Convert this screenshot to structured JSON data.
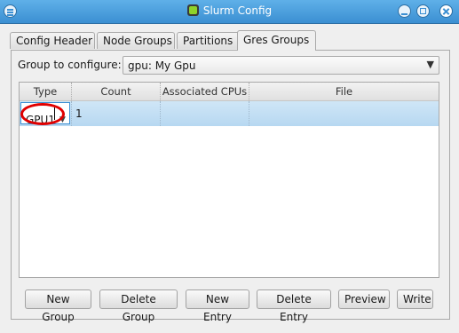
{
  "window": {
    "title": "Slurm Config"
  },
  "tabs": [
    {
      "label": "Config Header"
    },
    {
      "label": "Node Groups"
    },
    {
      "label": "Partitions"
    },
    {
      "label": "Gres Groups",
      "active": true
    }
  ],
  "group_select": {
    "label": "Group to configure:",
    "value": "gpu: My Gpu"
  },
  "table": {
    "columns": [
      "Type",
      "Count",
      "Associated CPUs",
      "File"
    ],
    "rows": [
      {
        "type": "GPU1",
        "count": "1",
        "associated_cpus": "",
        "file": ""
      }
    ]
  },
  "buttons": {
    "new_group": "New Group",
    "delete_group": "Delete Group",
    "new_entry": "New Entry",
    "delete_entry": "Delete Entry",
    "preview": "Preview",
    "write": "Write"
  },
  "colors": {
    "titlebar": "#3b8fd2",
    "selection": "#b7d8f1",
    "annotation": "#e00000"
  }
}
